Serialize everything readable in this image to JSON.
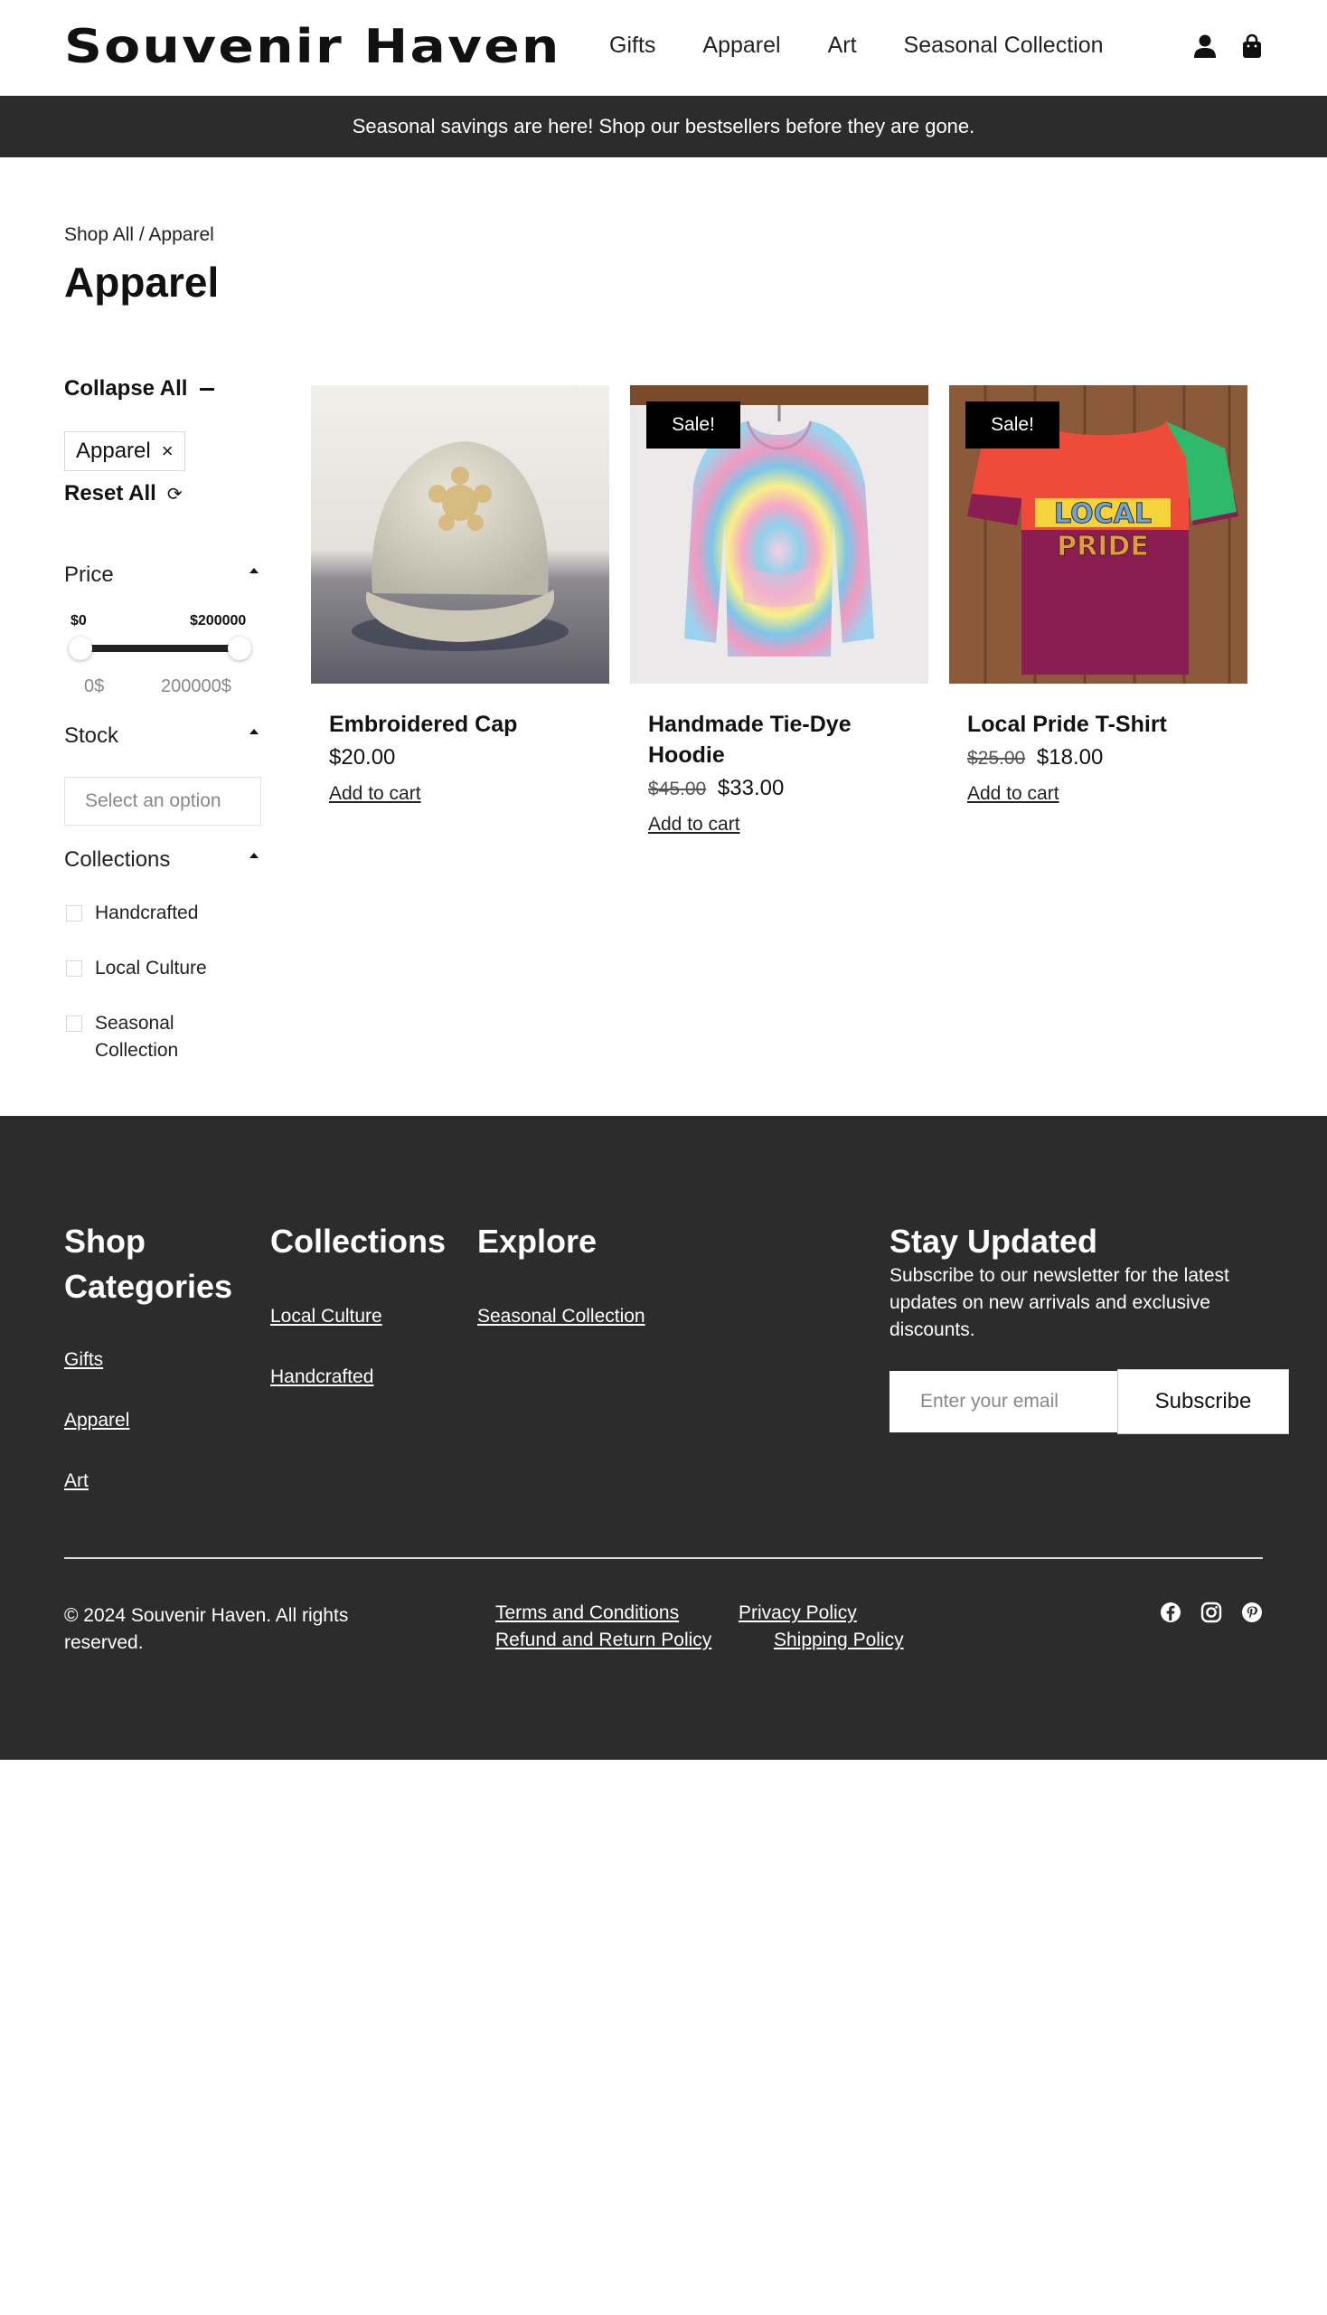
{
  "header": {
    "logo": "Souvenir Haven",
    "nav": [
      "Gifts",
      "Apparel",
      "Art",
      "Seasonal Collection"
    ],
    "icons": [
      "account-icon",
      "cart-icon"
    ]
  },
  "announcement": "Seasonal savings are here! Shop our bestsellers before they are gone.",
  "breadcrumb": "Shop All / Apparel",
  "page_title": "Apparel",
  "sidebar": {
    "collapse_all": "Collapse All",
    "active_filter": "Apparel",
    "remove_icon": "×",
    "reset_all": "Reset All",
    "reset_icon": "⟳",
    "price": {
      "label": "Price",
      "min_label": "$0",
      "max_label": "$200000",
      "min_value": "0$",
      "max_value": "200000$",
      "range_min": 0,
      "range_max": 200000
    },
    "stock": {
      "label": "Stock",
      "placeholder": "Select an option"
    },
    "collections": {
      "label": "Collections",
      "options": [
        "Handcrafted",
        "Local Culture",
        "Seasonal Collection"
      ]
    }
  },
  "products": [
    {
      "name": "Embroidered Cap",
      "price": "$20.00",
      "old_price": "",
      "sale": false,
      "add": "Add to cart"
    },
    {
      "name": "Handmade Tie-Dye Hoodie",
      "price": "$33.00",
      "old_price": "$45.00",
      "sale": true,
      "sale_label": "Sale!",
      "add": "Add to cart"
    },
    {
      "name": "Local Pride T-Shirt",
      "price": "$18.00",
      "old_price": "$25.00",
      "sale": true,
      "sale_label": "Sale!",
      "add": "Add to cart"
    }
  ],
  "tshirt_print": [
    "LOCAL",
    "PRIDE"
  ],
  "footer": {
    "shop_categories": {
      "title": "Shop Categories",
      "links": [
        "Gifts",
        "Apparel",
        "Art"
      ]
    },
    "collections": {
      "title": "Collections",
      "links": [
        "Local Culture",
        "Handcrafted"
      ]
    },
    "explore": {
      "title": "Explore",
      "links": [
        "Seasonal Collection"
      ]
    },
    "newsletter": {
      "title": "Stay Updated",
      "text": "Subscribe to our newsletter for the latest updates on new arrivals and exclusive discounts.",
      "placeholder": "Enter your email",
      "button": "Subscribe"
    },
    "copyright": "© 2024 Souvenir Haven. All rights reserved.",
    "policies": [
      "Terms and Conditions",
      "Privacy Policy",
      "Refund and Return Policy",
      "Shipping Policy"
    ],
    "social": [
      "facebook-icon",
      "instagram-icon",
      "pinterest-icon"
    ]
  },
  "colors": {
    "dark": "#2c2c2c",
    "sale_badge": "#000000",
    "white": "#ffffff"
  }
}
